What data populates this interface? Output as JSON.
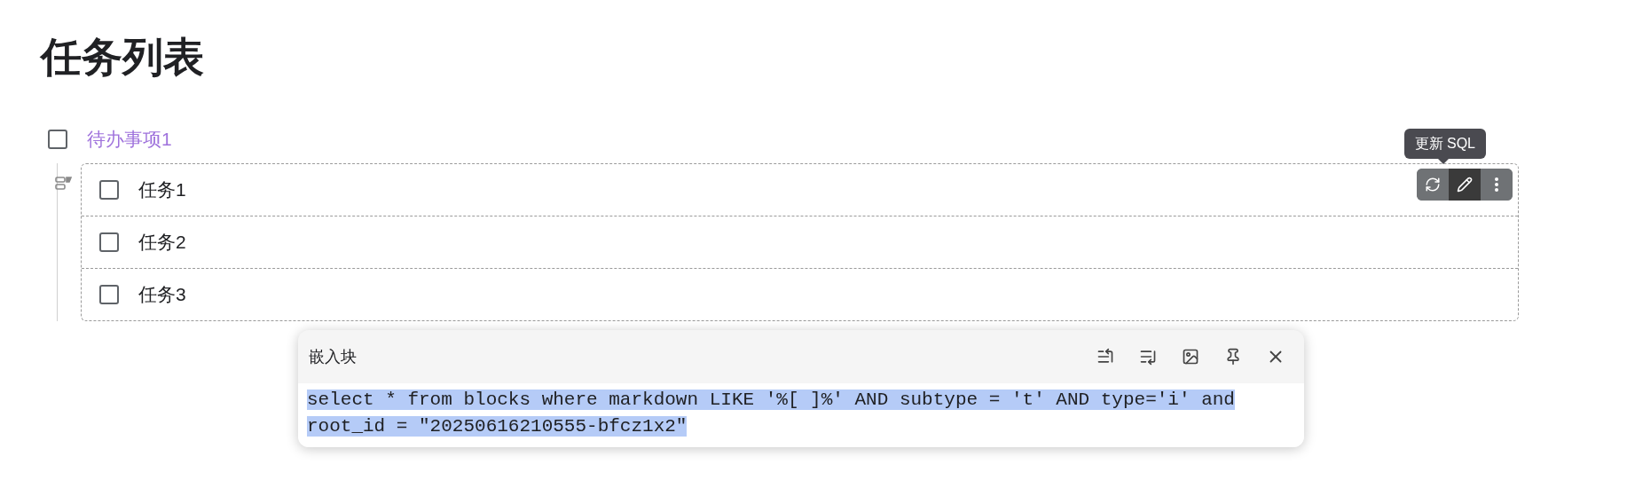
{
  "title": "任务列表",
  "todo": {
    "label": "待办事项1",
    "checked": false
  },
  "embed": {
    "items": [
      {
        "label": "任务1",
        "checked": false
      },
      {
        "label": "任务2",
        "checked": false
      },
      {
        "label": "任务3",
        "checked": false
      }
    ],
    "toolbar": [
      {
        "kind": "refresh",
        "active": false
      },
      {
        "kind": "edit",
        "active": true
      },
      {
        "kind": "more",
        "active": false
      }
    ],
    "tooltip": "更新 SQL"
  },
  "popup": {
    "title": "嵌入块",
    "actions": [
      {
        "kind": "left-align"
      },
      {
        "kind": "right-align"
      },
      {
        "kind": "image"
      },
      {
        "kind": "pin"
      },
      {
        "kind": "close"
      }
    ],
    "query": {
      "value": "select * from blocks where markdown LIKE '%[ ]%' AND subtype = 't' AND type='i' and root_id = \"20250616210555-bfcz1x2\"",
      "selected": true
    }
  }
}
